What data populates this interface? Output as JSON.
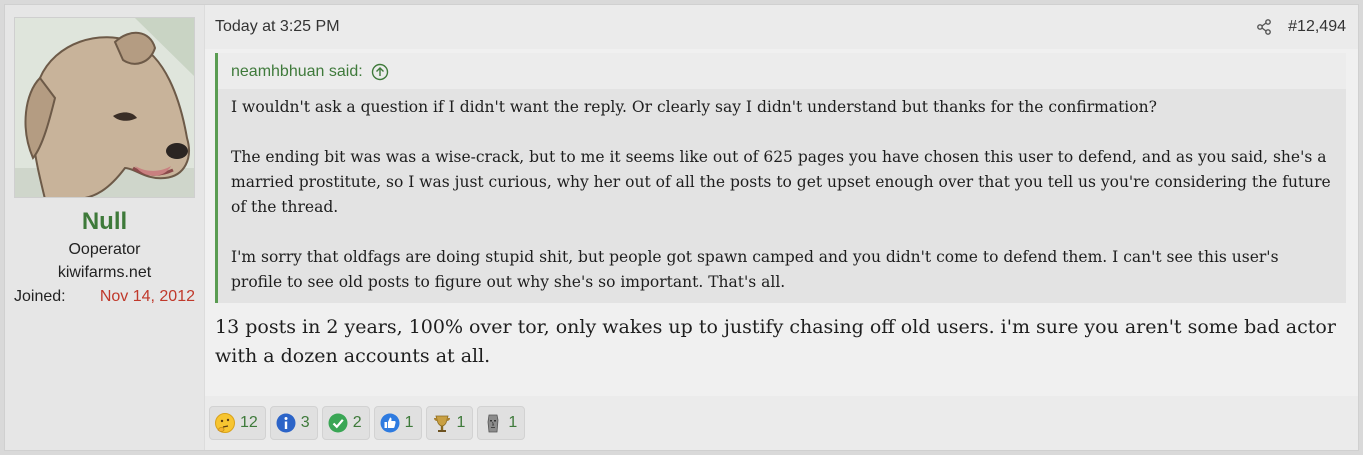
{
  "user": {
    "name": "Null",
    "title": "Ooperator",
    "banner": "kiwifarms.net",
    "joined_label": "Joined:",
    "joined_value": "Nov 14, 2012"
  },
  "post": {
    "timestamp": "Today at 3:25 PM",
    "number": "#12,494",
    "quote_author": "neamhbhuan said:",
    "quote_paragraphs": [
      "I wouldn't ask a question if I didn't want the reply. Or clearly say I didn't understand but thanks for the confirmation?",
      "The ending bit was was a wise-crack, but to me it seems like out of 625 pages you have chosen this user to defend, and as you said, she's a married prostitute, so I was just curious, why her out of all the posts to get upset enough over that you tell us you're considering the future of the thread.",
      "I'm sorry that oldfags are doing stupid shit, but people got spawn camped and you didn't come to defend them. I can't see this user's profile to see old posts to figure out why she's so important. That's all."
    ],
    "reply": "13 posts in 2 years, 100% over tor, only wakes up to justify chasing off old users. i'm sure you aren't some bad actor with a dozen accounts at all."
  },
  "reactions": [
    {
      "icon": "thinking-face-icon",
      "count": "12"
    },
    {
      "icon": "informative-icon",
      "count": "3"
    },
    {
      "icon": "checkmark-icon",
      "count": "2"
    },
    {
      "icon": "thumbs-up-icon",
      "count": "1"
    },
    {
      "icon": "winner-icon",
      "count": "1"
    },
    {
      "icon": "moai-icon",
      "count": "1"
    }
  ],
  "colors": {
    "username": "#3e7a3a",
    "joined_date": "#c0392b",
    "quote_border": "#5a9c52",
    "reaction_count": "#3e7a3a"
  }
}
